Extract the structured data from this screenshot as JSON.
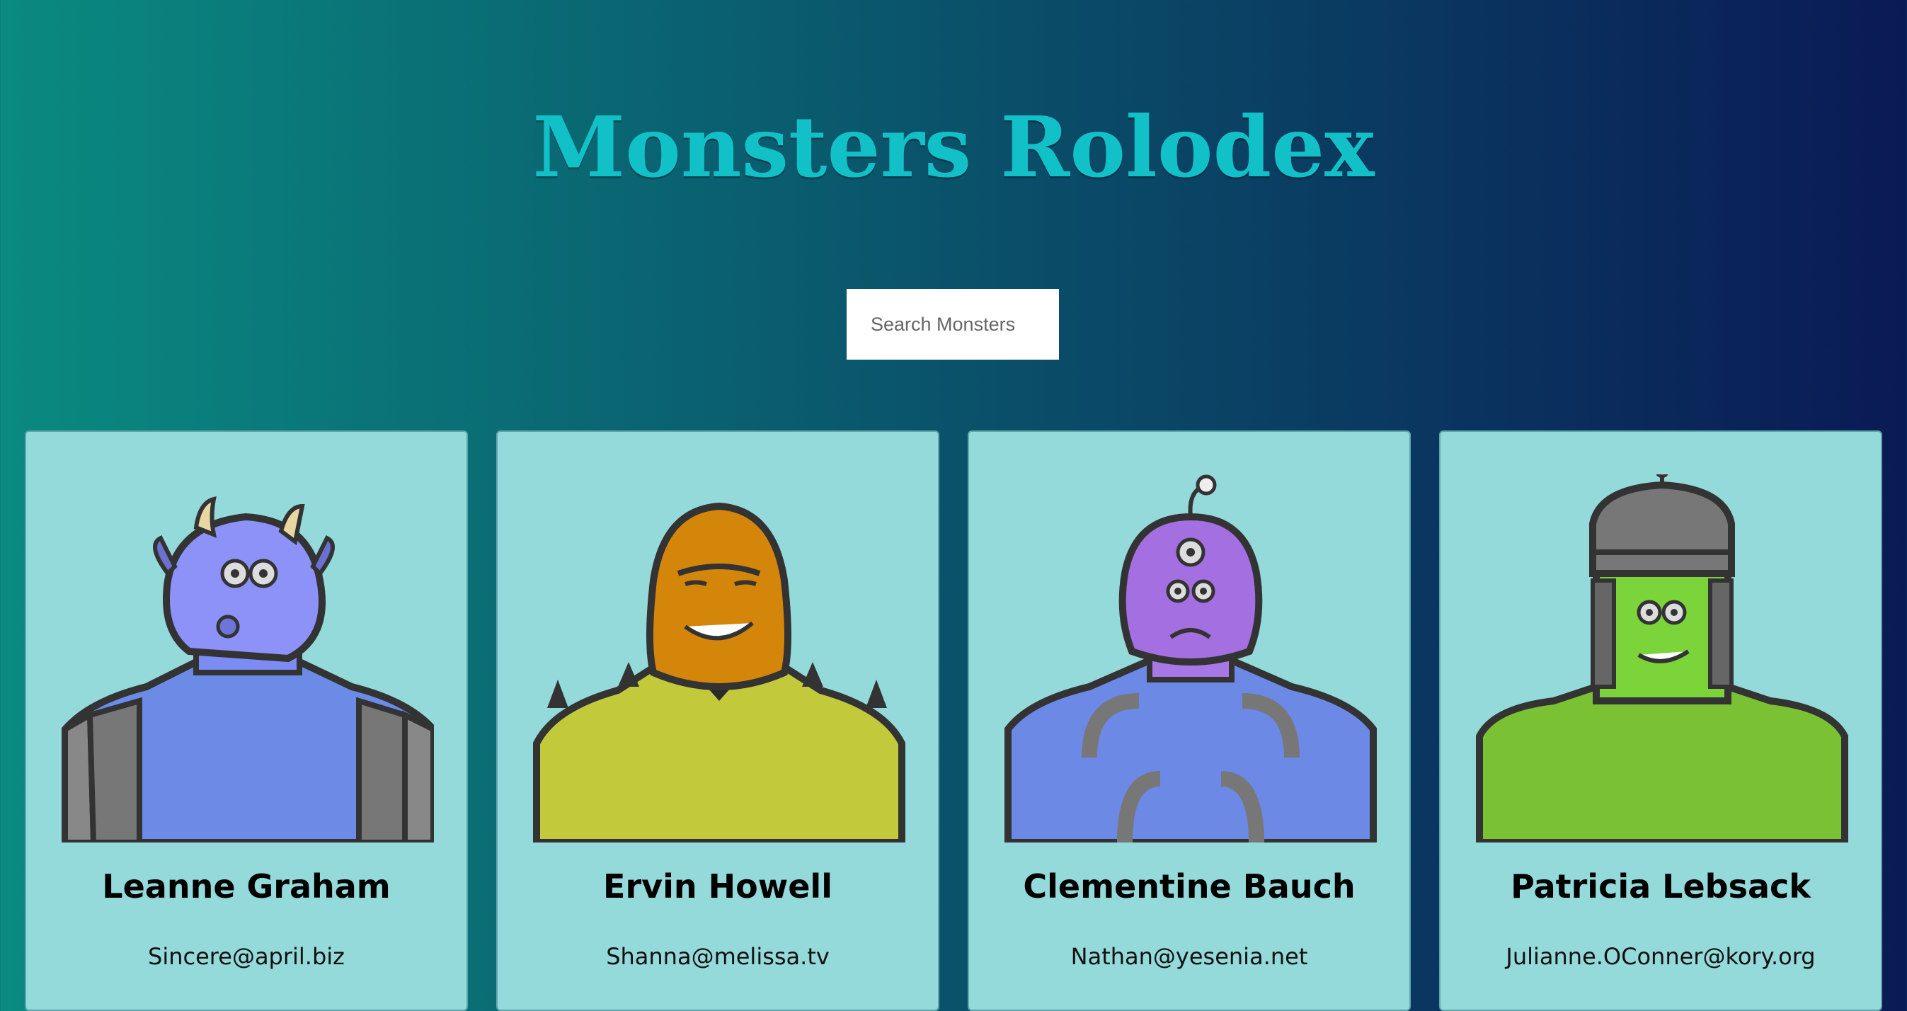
{
  "header": {
    "title": "Monsters Rolodex"
  },
  "search": {
    "placeholder": "Search Monsters"
  },
  "cards": [
    {
      "name": "Leanne Graham",
      "email": "Sincere@april.biz",
      "monster_icon": "horned-blue-monster-icon"
    },
    {
      "name": "Ervin Howell",
      "email": "Shanna@melissa.tv",
      "monster_icon": "orange-spiky-monster-icon"
    },
    {
      "name": "Clementine Bauch",
      "email": "Nathan@yesenia.net",
      "monster_icon": "purple-cyclops-robot-monster-icon"
    },
    {
      "name": "Patricia Lebsack",
      "email": "Julianne.OConner@kory.org",
      "monster_icon": "green-helmet-monster-icon"
    }
  ],
  "colors": {
    "title": "#12c1c8",
    "card_bg": "#95dada",
    "background_left": "#0a8a80",
    "background_right": "#0a1a55"
  }
}
